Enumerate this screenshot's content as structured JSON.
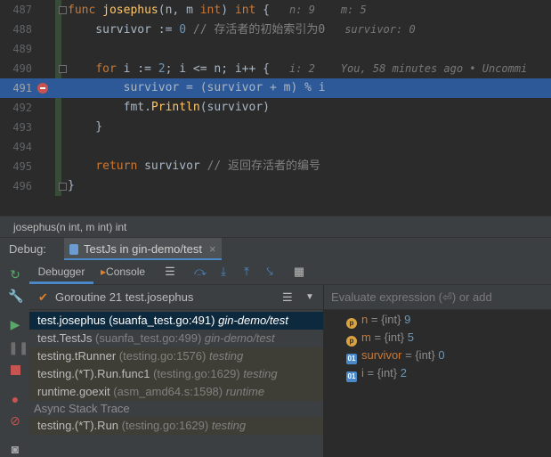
{
  "editor": {
    "lines": [
      {
        "num": "487",
        "tokens": [
          {
            "t": "func ",
            "c": "kw"
          },
          {
            "t": "josephus",
            "c": "fn"
          },
          {
            "t": "(n, m ",
            "c": ""
          },
          {
            "t": "int",
            "c": "kw"
          },
          {
            "t": ") ",
            "c": ""
          },
          {
            "t": "int",
            "c": "kw"
          },
          {
            "t": " {",
            "c": ""
          }
        ],
        "hint": "n: 9    m: 5"
      },
      {
        "num": "488",
        "tokens": [
          {
            "t": "    survivor := ",
            "c": ""
          },
          {
            "t": "0",
            "c": "num"
          },
          {
            "t": " // 存活者的初始索引为0",
            "c": "cm"
          }
        ],
        "hint": "survivor: 0"
      },
      {
        "num": "489",
        "tokens": [],
        "hint": ""
      },
      {
        "num": "490",
        "tokens": [
          {
            "t": "    ",
            "c": ""
          },
          {
            "t": "for",
            "c": "kw"
          },
          {
            "t": " i := ",
            "c": ""
          },
          {
            "t": "2",
            "c": "num"
          },
          {
            "t": "; i <= n; i++ {",
            "c": ""
          }
        ],
        "hint": "i: 2    You, 58 minutes ago • Uncommi"
      },
      {
        "num": "491",
        "tokens": [
          {
            "t": "        survivor = (survivor + m) % i",
            "c": ""
          }
        ],
        "hint": ""
      },
      {
        "num": "492",
        "tokens": [
          {
            "t": "        fmt.",
            "c": ""
          },
          {
            "t": "Println",
            "c": "call"
          },
          {
            "t": "(survivor)",
            "c": ""
          }
        ],
        "hint": ""
      },
      {
        "num": "493",
        "tokens": [
          {
            "t": "    }",
            "c": ""
          }
        ],
        "hint": ""
      },
      {
        "num": "494",
        "tokens": [],
        "hint": ""
      },
      {
        "num": "495",
        "tokens": [
          {
            "t": "    ",
            "c": ""
          },
          {
            "t": "return",
            "c": "kw"
          },
          {
            "t": " survivor ",
            "c": ""
          },
          {
            "t": "// 返回存活者的编号",
            "c": "cm"
          }
        ],
        "hint": ""
      },
      {
        "num": "496",
        "tokens": [
          {
            "t": "}",
            "c": ""
          }
        ],
        "hint": ""
      }
    ]
  },
  "breadcrumb": "josephus(n int, m int) int",
  "debug": {
    "label": "Debug:",
    "session_tab": "TestJs in gin-demo/test",
    "close_glyph": "×"
  },
  "toolbar": {
    "debugger_tab": "Debugger",
    "console_tab": "Console"
  },
  "goroutine": {
    "label": "Goroutine 21 test.josephus"
  },
  "frames": [
    {
      "func": "test.josephus",
      "loc": " (suanfa_test.go:491) ",
      "lib": "gin-demo/test",
      "selected": true,
      "libstyle": false
    },
    {
      "func": "test.TestJs",
      "loc": " (suanfa_test.go:499) ",
      "lib": "gin-demo/test",
      "selected": false,
      "libstyle": false
    },
    {
      "func": "testing.tRunner",
      "loc": " (testing.go:1576) ",
      "lib": "testing",
      "selected": false,
      "libstyle": true
    },
    {
      "func": "testing.(*T).Run.func1",
      "loc": " (testing.go:1629) ",
      "lib": "testing",
      "selected": false,
      "libstyle": true
    },
    {
      "func": "runtime.goexit",
      "loc": " (asm_amd64.s:1598) ",
      "lib": "runtime",
      "selected": false,
      "libstyle": true
    }
  ],
  "async_header": "Async Stack Trace",
  "async_frames": [
    {
      "func": "testing.(*T).Run",
      "loc": " (testing.go:1629) ",
      "lib": "testing"
    }
  ],
  "evaluate_placeholder": "Evaluate expression (⏎) or add",
  "variables": [
    {
      "kind": "p",
      "icon": "p",
      "name": "n",
      "type": "{int}",
      "value": "9"
    },
    {
      "kind": "p",
      "icon": "p",
      "name": "m",
      "type": "{int}",
      "value": "5"
    },
    {
      "kind": "o",
      "icon": "01",
      "name": "survivor",
      "type": "{int}",
      "value": "0"
    },
    {
      "kind": "o",
      "icon": "01",
      "name": "i",
      "type": "{int}",
      "value": "2"
    }
  ]
}
